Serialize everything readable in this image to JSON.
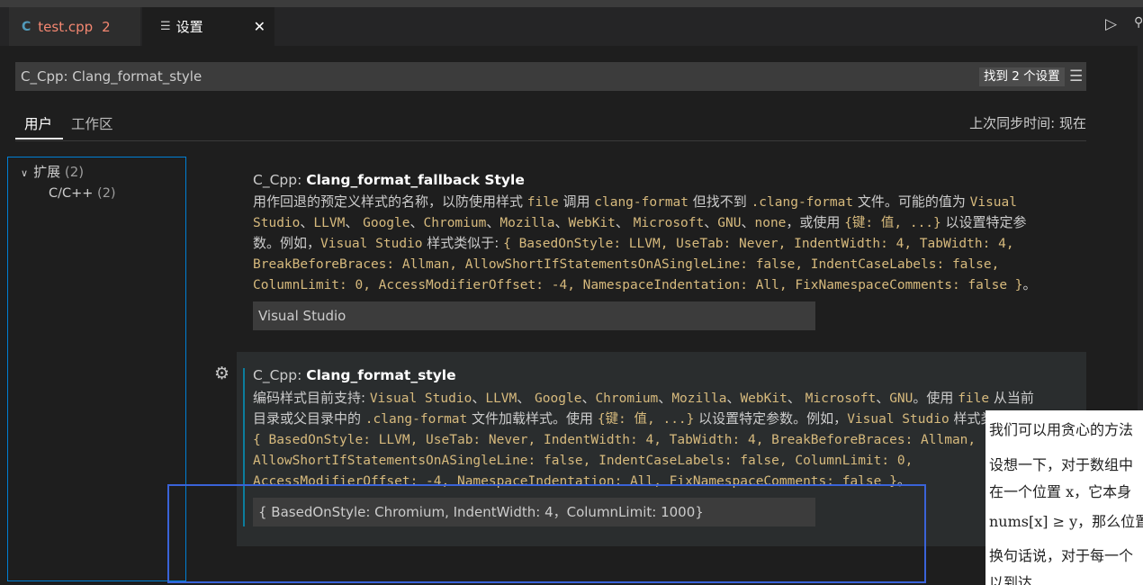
{
  "tabs": {
    "file_tab": {
      "label": "test.cpp",
      "badge": "2",
      "icon": "cpp-file-icon"
    },
    "settings_tab": {
      "label": "设置",
      "icon": "settings-doc-icon",
      "close": "✕"
    }
  },
  "search": {
    "value": "C_Cpp: Clang_format_style",
    "found": "找到 2 个设置"
  },
  "scope": {
    "user": "用户",
    "workspace": "工作区",
    "sync": "上次同步时间: 现在"
  },
  "toc": {
    "extensions": "扩展",
    "extensions_count": "(2)",
    "cpp": "C/C++",
    "cpp_count": "(2)"
  },
  "setting1": {
    "prefix": "C_Cpp: ",
    "name": "Clang_format_fallback Style",
    "desc_lines": [
      "用作回退的预定义样式的名称，以防使用样式 file 调用 clang-format 但找不到 .clang-format 文件。可能的值为 Visual",
      "Studio、LLVM、 Google、Chromium、Mozilla、WebKit、 Microsoft、GNU、none，或使用 {键: 值, ...} 以设置特定参",
      "数。例如，Visual Studio 样式类似于: { BasedOnStyle: LLVM, UseTab: Never, IndentWidth: 4, TabWidth: 4,",
      "BreakBeforeBraces: Allman, AllowShortIfStatementsOnASingleLine: false, IndentCaseLabels: false,",
      "ColumnLimit: 0, AccessModifierOffset: -4, NamespaceIndentation: All, FixNamespaceComments: false }。"
    ],
    "value": "Visual Studio"
  },
  "setting2": {
    "prefix": "C_Cpp: ",
    "name": "Clang_format_style",
    "desc_lines": [
      "编码样式目前支持: Visual Studio、LLVM、 Google、Chromium、Mozilla、WebKit、 Microsoft、GNU。使用 file 从当前",
      "目录或父目录中的 .clang-format 文件加载样式。使用 {键: 值, ...} 以设置特定参数。例如，Visual Studio 样式类似于:",
      "{ BasedOnStyle: LLVM, UseTab: Never, IndentWidth: 4, TabWidth: 4, BreakBeforeBraces: Allman,",
      "AllowShortIfStatementsOnASingleLine: false, IndentCaseLabels: false, ColumnLimit: 0,",
      "AccessModifierOffset: -4, NamespaceIndentation: All, FixNamespaceComments: false }。"
    ],
    "value": "{ BasedOnStyle: Chromium, IndentWidth: 4，ColumnLimit: 1000}"
  },
  "overlay": {
    "lines": [
      "我们可以用贪心的方法",
      "设想一下，对于数组中",
      "在一个位置 x，它本身",
      "nums[x] ≥ y，那么位置",
      "换句话说，对于每一个",
      "以到达"
    ]
  },
  "colors": {
    "accent": "#007fd4",
    "modified": "#0c7d9d",
    "error": "#f48771",
    "code": "#d7ba7d",
    "annotation_box": "#3a63d8"
  }
}
